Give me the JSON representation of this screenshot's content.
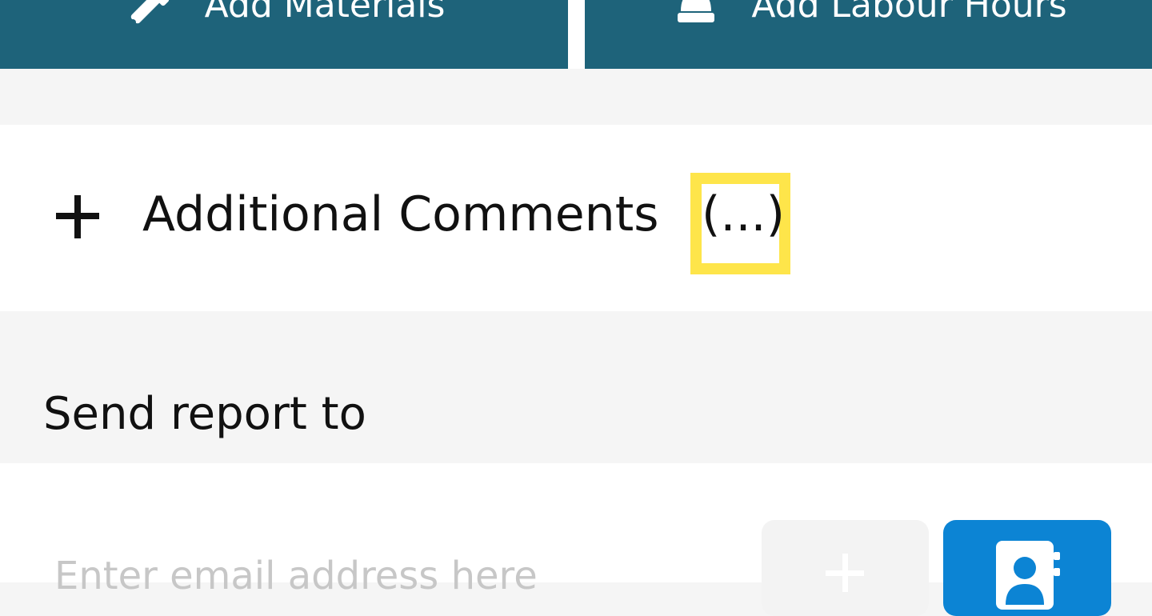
{
  "toolbar": {
    "materials_label": "Add Materials",
    "materials_icon": "tools-icon",
    "labour_label": "Add Labour Hours",
    "labour_icon": "hard-hat-icon"
  },
  "comments": {
    "toggle_icon": "plus-icon",
    "title": "Additional Comments",
    "ellipsis": "(...)",
    "highlight_color": "#fee54a"
  },
  "send_report": {
    "label": "Send report to",
    "email_placeholder": "Enter email address here",
    "add_icon": "plus-icon",
    "contacts_icon": "contact-book-icon"
  },
  "colors": {
    "primary_bar": "#1e637a",
    "contacts_button": "#0c84d4",
    "add_button": "#f3f3f3",
    "background": "#f5f5f5"
  }
}
